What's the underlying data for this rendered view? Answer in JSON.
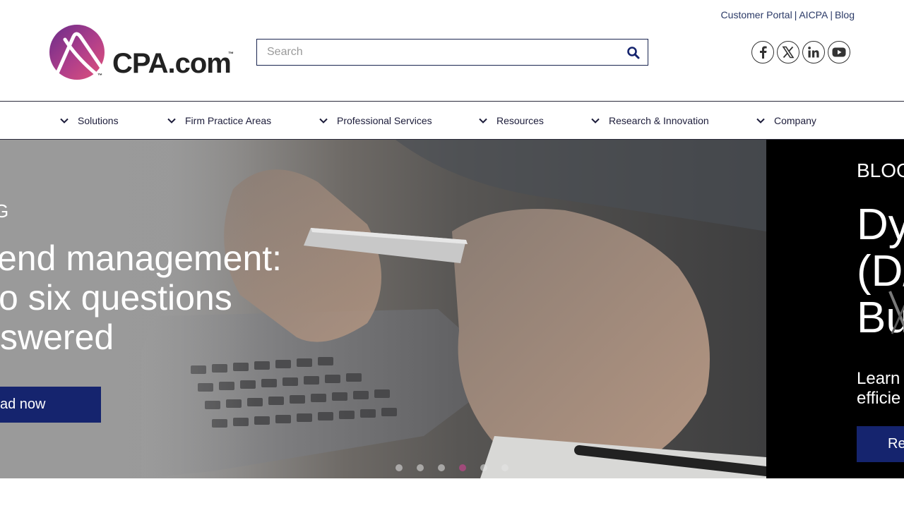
{
  "utility_links": {
    "customer_portal": "Customer Portal",
    "aicpa": "AICPA",
    "blog": "Blog",
    "separator": "|"
  },
  "logo": {
    "text": "CPA.com",
    "tm": "™"
  },
  "search": {
    "placeholder": "Search",
    "value": ""
  },
  "socials": [
    {
      "icon": "facebook-icon"
    },
    {
      "icon": "x-icon"
    },
    {
      "icon": "linkedin-icon"
    },
    {
      "icon": "youtube-icon"
    }
  ],
  "nav": {
    "items": [
      {
        "label": "Solutions"
      },
      {
        "label": "Firm Practice Areas"
      },
      {
        "label": "Professional Services"
      },
      {
        "label": "Resources"
      },
      {
        "label": "Research & Innovation"
      },
      {
        "label": "Company"
      }
    ]
  },
  "hero": {
    "slide_left": {
      "eyebrow": "G",
      "headline_line1": "end management:",
      "headline_line2": "o six questions",
      "headline_line3": "swered",
      "cta_label": "ad now"
    },
    "slide_right": {
      "eyebrow": "BLOG",
      "headline_line1": "Dy",
      "headline_line2": "(D/",
      "headline_line3": "Bu",
      "sub_line1": "Learn",
      "sub_line2": "efficie",
      "cta_label": "Re"
    },
    "dots": {
      "count": 6,
      "active_index": 3
    }
  },
  "colors": {
    "brand_navy": "#15246e",
    "active_dot": "#a04a7a",
    "logo_gradient_start": "#c2408a",
    "logo_gradient_end": "#5b2a86"
  }
}
